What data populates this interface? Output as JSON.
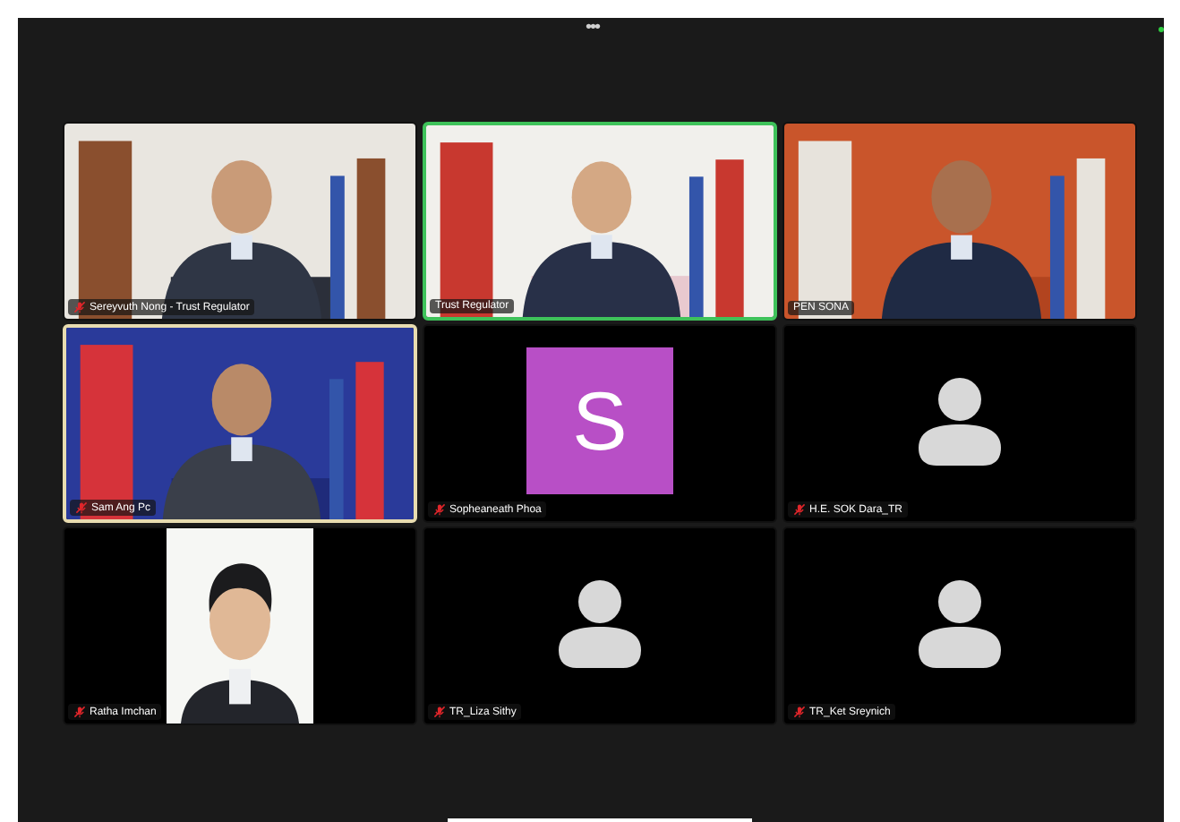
{
  "meeting_controls": {
    "more_label": "•••"
  },
  "tiles": [
    {
      "kind": "video",
      "name": "Sereyvuth Nong - Trust Regulator",
      "muted": true,
      "speaking": false,
      "pinned": false
    },
    {
      "kind": "video",
      "name": "Trust Regulator",
      "muted": false,
      "speaking": true,
      "pinned": false
    },
    {
      "kind": "video",
      "name": "PEN SONA",
      "muted": false,
      "speaking": false,
      "pinned": false
    },
    {
      "kind": "video",
      "name": "Sam Ang Pc",
      "muted": true,
      "speaking": false,
      "pinned": true
    },
    {
      "kind": "initial",
      "initial": "S",
      "name": "Sopheaneath Phoa",
      "muted": true,
      "speaking": false,
      "pinned": false
    },
    {
      "kind": "silhouette",
      "name": "H.E. SOK Dara_TR",
      "muted": true,
      "speaking": false,
      "pinned": false
    },
    {
      "name": "Ratha Imchan",
      "muted": true,
      "speaking": false,
      "pinned": false
    },
    {
      "kind": "silhouette",
      "name": "TR_Liza Sithy",
      "muted": true,
      "speaking": false,
      "pinned": false
    },
    {
      "kind": "silhouette",
      "name": "TR_Ket Sreynich",
      "muted": true,
      "speaking": false,
      "pinned": false
    }
  ]
}
